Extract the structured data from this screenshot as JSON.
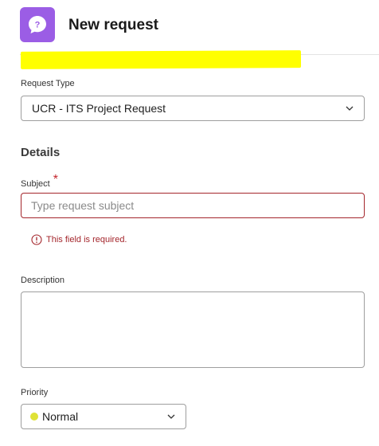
{
  "header": {
    "title": "New request",
    "icon": "chat-question-icon",
    "icon_color": "#9b5de5"
  },
  "request_type": {
    "label": "Request Type",
    "value": "UCR - ITS Project Request"
  },
  "details": {
    "section_title": "Details"
  },
  "subject": {
    "label": "Subject",
    "required_marker": "*",
    "placeholder": "Type request subject",
    "value": "",
    "error": "This field is required."
  },
  "description": {
    "label": "Description",
    "value": ""
  },
  "priority": {
    "label": "Priority",
    "value": "Normal",
    "dot_color": "#dfe236"
  },
  "colors": {
    "error": "#a4262c",
    "highlight": "#ffff00"
  }
}
